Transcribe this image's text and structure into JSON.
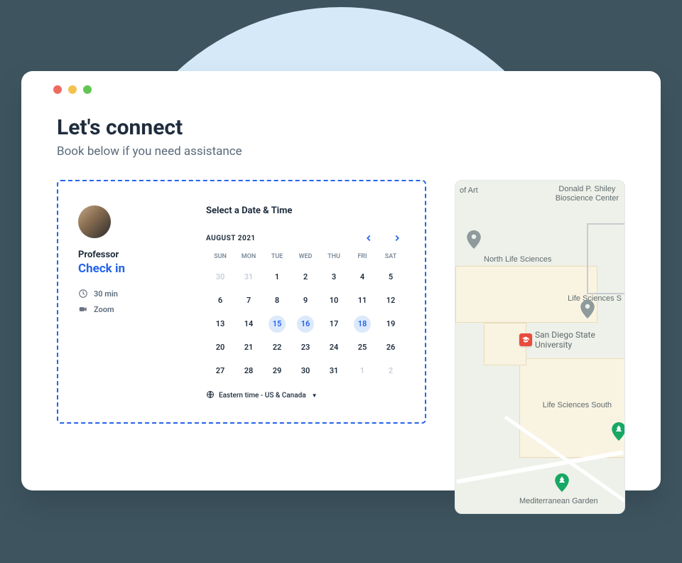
{
  "header": {
    "title": "Let's connect",
    "subtitle": "Book below if you need assistance"
  },
  "booking": {
    "host_role": "Professor",
    "event_type": "Check in",
    "duration_label": "30 min",
    "location_label": "Zoom",
    "select_label": "Select a Date & Time",
    "month_label": "AUGUST 2021",
    "timezone_label": "Eastern time - US & Canada",
    "dow": [
      "SUN",
      "MON",
      "TUE",
      "WED",
      "THU",
      "FRI",
      "SAT"
    ],
    "days": [
      {
        "n": "30",
        "outside": true
      },
      {
        "n": "31",
        "outside": true
      },
      {
        "n": "1"
      },
      {
        "n": "2"
      },
      {
        "n": "3"
      },
      {
        "n": "4"
      },
      {
        "n": "5"
      },
      {
        "n": "6"
      },
      {
        "n": "7"
      },
      {
        "n": "8"
      },
      {
        "n": "9"
      },
      {
        "n": "10"
      },
      {
        "n": "11"
      },
      {
        "n": "12"
      },
      {
        "n": "13"
      },
      {
        "n": "14"
      },
      {
        "n": "15",
        "available": true
      },
      {
        "n": "16",
        "available": true
      },
      {
        "n": "17"
      },
      {
        "n": "18",
        "available": true
      },
      {
        "n": "19"
      },
      {
        "n": "20"
      },
      {
        "n": "21"
      },
      {
        "n": "22"
      },
      {
        "n": "23"
      },
      {
        "n": "24"
      },
      {
        "n": "25"
      },
      {
        "n": "26"
      },
      {
        "n": "27"
      },
      {
        "n": "28"
      },
      {
        "n": "29"
      },
      {
        "n": "30"
      },
      {
        "n": "31"
      },
      {
        "n": "1",
        "outside": true
      },
      {
        "n": "2",
        "outside": true
      }
    ]
  },
  "map": {
    "labels": {
      "top_left": "of Art",
      "top_right": "Donald P. Shiley\nBioscience Center",
      "north_life": "North Life Sciences",
      "life_sci_se": "Life Sciences S",
      "life_sci_south": "Life Sciences South",
      "med_garden": "Mediterranean Garden",
      "university": "San Diego State\nUniversity"
    }
  }
}
